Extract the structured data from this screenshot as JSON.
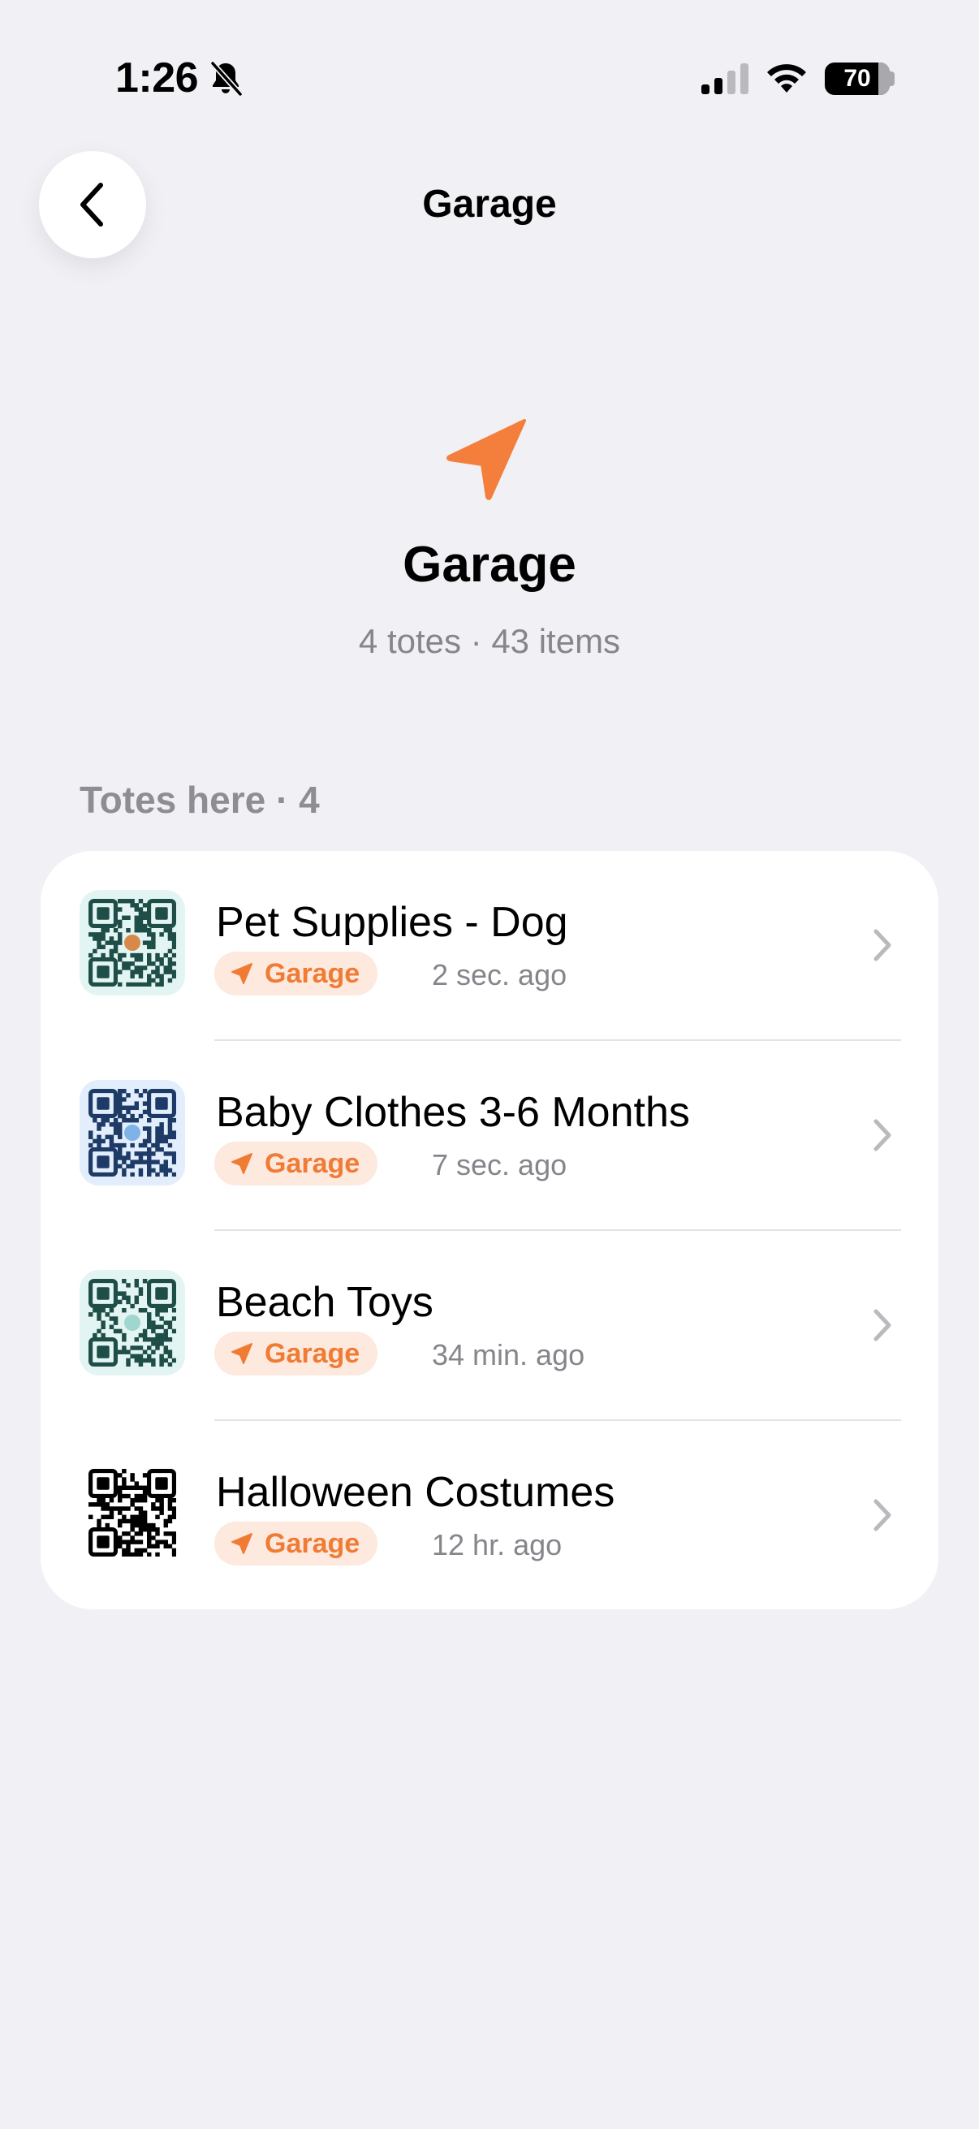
{
  "status_bar": {
    "time": "1:26",
    "battery": "70"
  },
  "nav": {
    "title": "Garage",
    "back_icon": "chevron-left-icon"
  },
  "header": {
    "icon": "location-arrow-icon",
    "name": "Garage",
    "summary": "4 totes · 43 items"
  },
  "section": {
    "title": "Totes here · 4"
  },
  "colors": {
    "accent": "#f07b35",
    "badge_bg": "#fde9dd",
    "background": "#f1f0f5",
    "secondary_text": "#86858b"
  },
  "totes": [
    {
      "name": "Pet Supplies - Dog",
      "location": "Garage",
      "updated": "2 sec. ago",
      "qr_color": "#1f4d48",
      "qr_bg": "#e3f5f2",
      "qr_emblem": "dog"
    },
    {
      "name": "Baby Clothes 3-6 Months",
      "location": "Garage",
      "updated": "7 sec. ago",
      "qr_color": "#1e3a66",
      "qr_bg": "#e2eefb",
      "qr_emblem": "shirt"
    },
    {
      "name": "Beach Toys",
      "location": "Garage",
      "updated": "34 min. ago",
      "qr_color": "#1f4d48",
      "qr_bg": "#e3f5f2",
      "qr_emblem": "wave"
    },
    {
      "name": "Halloween Costumes",
      "location": "Garage",
      "updated": "12 hr. ago",
      "qr_color": "#000000",
      "qr_bg": "#ffffff",
      "qr_emblem": "none"
    }
  ]
}
